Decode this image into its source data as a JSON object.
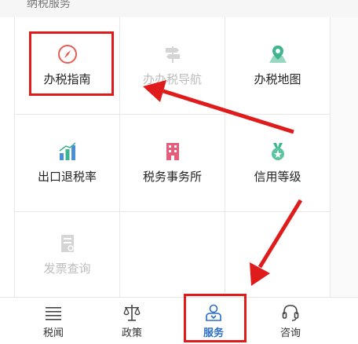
{
  "section": {
    "title": "纳税服务"
  },
  "grid": {
    "items": [
      {
        "label": "办税指南",
        "icon": "compass-icon"
      },
      {
        "label": "办办税导航",
        "icon": "signpost-icon"
      },
      {
        "label": "办税地图",
        "icon": "map-pin-icon"
      },
      {
        "label": "出口退税率",
        "icon": "bar-chart-icon"
      },
      {
        "label": "税务事务所",
        "icon": "building-icon"
      },
      {
        "label": "信用等级",
        "icon": "medal-icon"
      },
      {
        "label": "发票查询",
        "icon": "invoice-icon"
      }
    ]
  },
  "tabbar": {
    "items": [
      {
        "label": "税闻",
        "icon": "news-lines-icon"
      },
      {
        "label": "政策",
        "icon": "scales-icon"
      },
      {
        "label": "服务",
        "icon": "service-person-icon",
        "active": true
      },
      {
        "label": "咨询",
        "icon": "headset-icon"
      }
    ]
  },
  "colors": {
    "accent": "#2a6ec8",
    "annotation": "#e01b1b",
    "green": "#3fb58f",
    "pink": "#e65c7b"
  }
}
